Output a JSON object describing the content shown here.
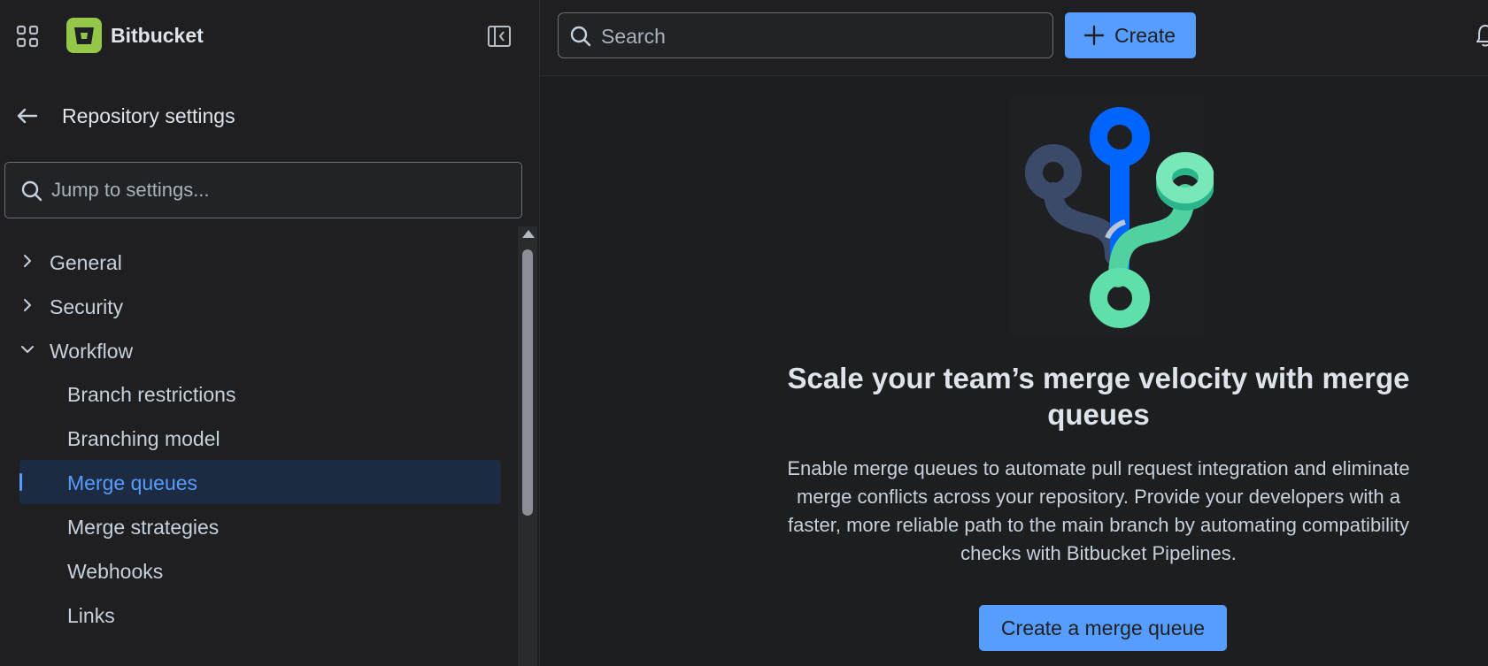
{
  "app": {
    "brand": "Bitbucket",
    "icons": {
      "app_switcher": "grid-icon",
      "logo": "bitbucket-logo-icon",
      "collapse": "sidebar-collapse-icon",
      "back": "arrow-left-icon",
      "search": "search-icon",
      "plus": "plus-icon",
      "bell": "bell-icon",
      "chevron_right": "chevron-right-icon",
      "chevron_down": "chevron-down-icon"
    },
    "colors": {
      "accent": "#579dff",
      "logo_green": "#94c748",
      "background": "#1d1e20"
    }
  },
  "sidebar": {
    "back_label": "Repository settings",
    "jump_placeholder": "Jump to settings...",
    "groups": [
      {
        "label": "General",
        "expanded": false
      },
      {
        "label": "Security",
        "expanded": false
      },
      {
        "label": "Workflow",
        "expanded": true
      }
    ],
    "workflow_items": [
      {
        "label": "Branch restrictions",
        "active": false
      },
      {
        "label": "Branching model",
        "active": false
      },
      {
        "label": "Merge queues",
        "active": true
      },
      {
        "label": "Merge strategies",
        "active": false
      },
      {
        "label": "Webhooks",
        "active": false
      },
      {
        "label": "Links",
        "active": false
      }
    ]
  },
  "topbar": {
    "search_placeholder": "Search",
    "create_label": "Create"
  },
  "main": {
    "headline": "Scale your team’s merge velocity with merge queues",
    "description": "Enable merge queues to automate pull request integration and eliminate merge conflicts across your repository. Provide your developers with a faster, more reliable path to the main branch by automating compatibility checks with Bitbucket Pipelines.",
    "cta_label": "Create a merge queue"
  }
}
